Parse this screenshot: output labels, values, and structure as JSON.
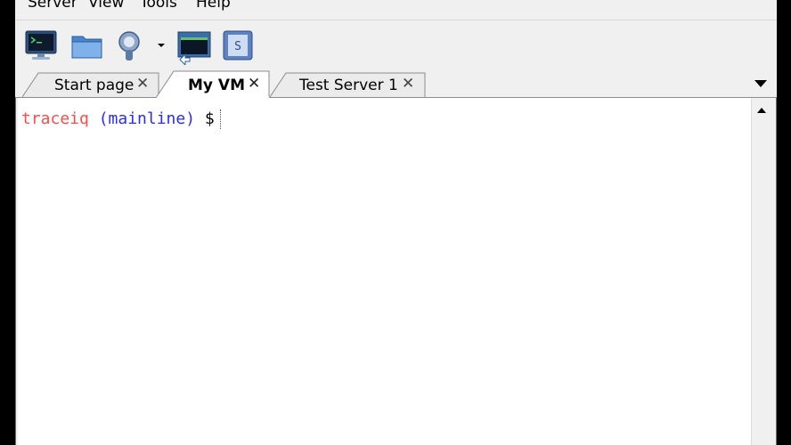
{
  "menu": {
    "items": [
      {
        "label": "Server"
      },
      {
        "label": "View"
      },
      {
        "label": "Tools"
      },
      {
        "label": "Help"
      }
    ]
  },
  "toolbar": {
    "buttons": [
      {
        "icon": "monitor-icon"
      },
      {
        "icon": "folder-icon"
      },
      {
        "icon": "tools-wizard-icon"
      },
      {
        "icon": "terminal-window-icon"
      },
      {
        "icon": "script-icon"
      }
    ]
  },
  "tabs": [
    {
      "label": "Start page",
      "active": false
    },
    {
      "label": "My VM",
      "active": true
    },
    {
      "label": "Test Server 1",
      "active": false
    }
  ],
  "terminal": {
    "user": "traceiq",
    "branch": "(mainline)",
    "symbol": "$"
  },
  "colors": {
    "prompt_user": "#ff4a4a",
    "prompt_branch": "#2a2aff",
    "prompt_symbol": "#000000",
    "accent": "#3f7cc5"
  }
}
